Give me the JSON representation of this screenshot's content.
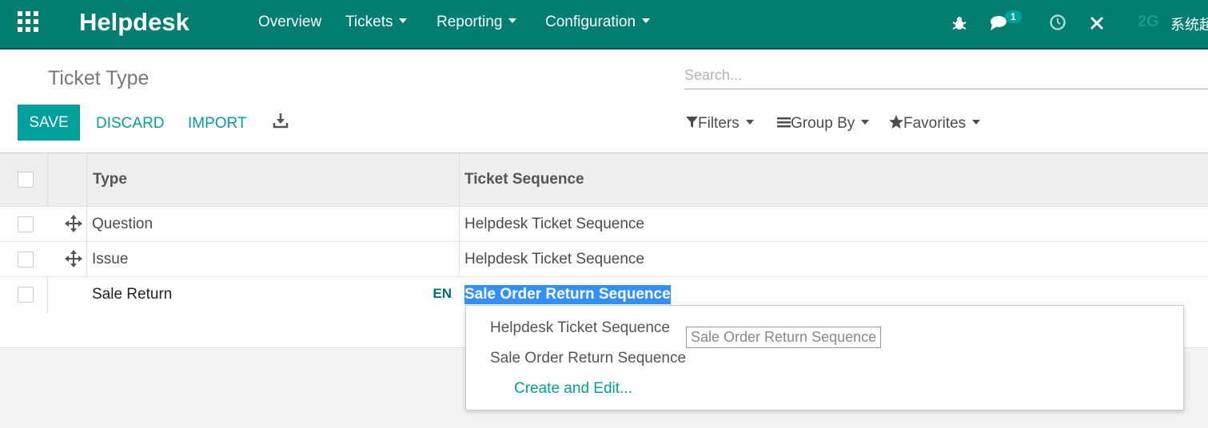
{
  "navbar": {
    "brand": "Helpdesk",
    "menus": [
      "Overview",
      "Tickets",
      "Reporting",
      "Configuration"
    ],
    "message_count": "1",
    "avatar_text": "2G",
    "user_name": "系统超"
  },
  "control_panel": {
    "title": "Ticket Type",
    "search_placeholder": "Search...",
    "buttons": {
      "save": "SAVE",
      "discard": "DISCARD",
      "import": "IMPORT"
    },
    "filters": "Filters",
    "group_by": "Group By",
    "favorites": "Favorites"
  },
  "table": {
    "columns": [
      "Type",
      "Ticket Sequence"
    ],
    "rows": [
      {
        "type": "Question",
        "sequence": "Helpdesk Ticket Sequence"
      },
      {
        "type": "Issue",
        "sequence": "Helpdesk Ticket Sequence"
      }
    ],
    "editing_row": {
      "type": "Sale Return",
      "lang": "EN",
      "sequence": "Sale Order Return Sequence"
    }
  },
  "dropdown": {
    "options": [
      "Helpdesk Ticket Sequence",
      "Sale Order Return Sequence"
    ],
    "create_edit": "Create and Edit...",
    "tooltip": "Sale Order Return Sequence"
  },
  "colors": {
    "navbar": "#017e70",
    "accent": "#00a09d",
    "selection": "#3390ff"
  }
}
